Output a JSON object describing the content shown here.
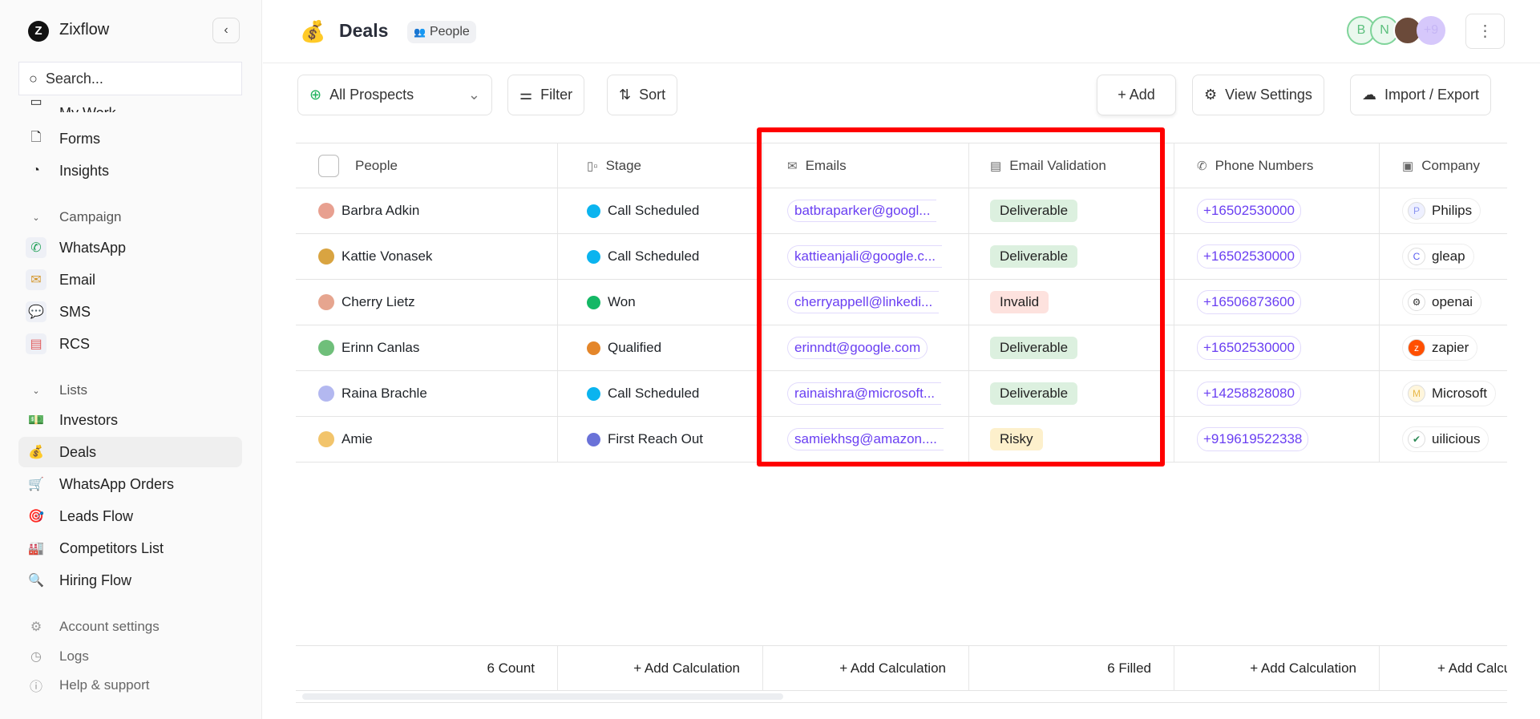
{
  "sidebar": {
    "brand": "Zixflow",
    "search_placeholder": "Search...",
    "items_top": [
      {
        "label": "My Work"
      },
      {
        "label": "Forms"
      },
      {
        "label": "Insights"
      }
    ],
    "campaign_label": "Campaign",
    "campaign": [
      {
        "label": "WhatsApp"
      },
      {
        "label": "Email"
      },
      {
        "label": "SMS"
      },
      {
        "label": "RCS"
      }
    ],
    "lists_label": "Lists",
    "lists": [
      {
        "label": "Investors",
        "icon": "💵"
      },
      {
        "label": "Deals",
        "icon": "💰"
      },
      {
        "label": "WhatsApp Orders",
        "icon": "🛒"
      },
      {
        "label": "Leads Flow",
        "icon": "🎯"
      },
      {
        "label": "Competitors List",
        "icon": "🏭"
      },
      {
        "label": "Hiring Flow",
        "icon": "🔍"
      }
    ],
    "footer": [
      {
        "label": "Account settings"
      },
      {
        "label": "Logs"
      },
      {
        "label": "Help & support"
      }
    ],
    "active": "Deals"
  },
  "header": {
    "icon": "💰",
    "title": "Deals",
    "badge": "People",
    "avatars": [
      "B",
      "N",
      "",
      "+9"
    ]
  },
  "toolbar": {
    "view": "All Prospects",
    "filter": "Filter",
    "sort": "Sort",
    "add": "+ Add",
    "view_settings": "View Settings",
    "import_export": "Import / Export"
  },
  "table": {
    "columns": [
      "People",
      "Stage",
      "Emails",
      "Email Validation",
      "Phone Numbers",
      "Company"
    ],
    "rows": [
      {
        "name": "Barbra Adkin",
        "stage": "Call Scheduled",
        "stage_color": "#0bb4ef",
        "email": "batbraparker@googl...",
        "validation": "Deliverable",
        "phone": "+16502530000",
        "company": "Philips"
      },
      {
        "name": "Kattie Vonasek",
        "stage": "Call Scheduled",
        "stage_color": "#0bb4ef",
        "email": "kattieanjali@google.c...",
        "validation": "Deliverable",
        "phone": "+16502530000",
        "company": "gleap"
      },
      {
        "name": "Cherry Lietz",
        "stage": "Won",
        "stage_color": "#14b865",
        "email": "cherryappell@linkedi...",
        "validation": "Invalid",
        "phone": "+16506873600",
        "company": "openai"
      },
      {
        "name": "Erinn Canlas",
        "stage": "Qualified",
        "stage_color": "#e4862a",
        "email": "erinndt@google.com",
        "validation": "Deliverable",
        "phone": "+16502530000",
        "company": "zapier"
      },
      {
        "name": "Raina Brachle",
        "stage": "Call Scheduled",
        "stage_color": "#0bb4ef",
        "email": "rainaishra@microsoft...",
        "validation": "Deliverable",
        "phone": "+14258828080",
        "company": "Microsoft"
      },
      {
        "name": "Amie",
        "stage": "First Reach Out",
        "stage_color": "#6a72d8",
        "email": "samiekhsg@amazon....",
        "validation": "Risky",
        "phone": "+919619522338",
        "company": "uilicious"
      }
    ],
    "validation_colors": {
      "Deliverable": "#dcf0df",
      "Invalid": "#fde2de",
      "Risky": "#fdf0cc"
    },
    "footer": [
      "6  Count",
      "+ Add Calculation",
      "+ Add Calculation",
      "6 Filled",
      "+ Add Calculation",
      "+ Add Calculation"
    ]
  }
}
